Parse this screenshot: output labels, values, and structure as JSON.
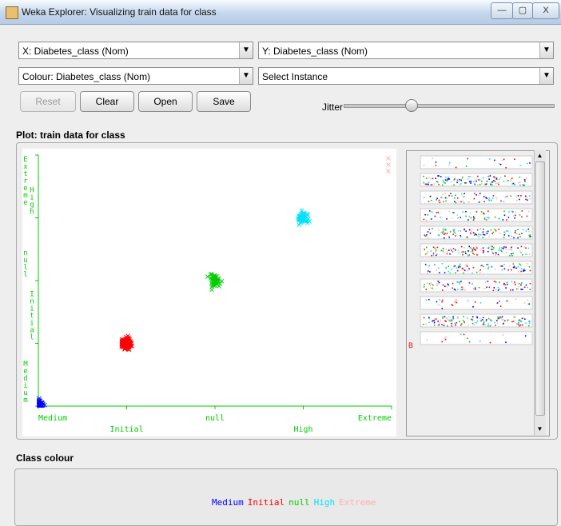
{
  "window": {
    "title": "Weka Explorer: Visualizing train data for class",
    "minimize_label": "—",
    "maximize_label": "▢",
    "close_label": "X"
  },
  "controls": {
    "x_axis": "X: Diabetes_class (Nom)",
    "y_axis": "Y: Diabetes_class (Nom)",
    "colour": "Colour: Diabetes_class (Nom)",
    "select_instance": "Select Instance",
    "reset_label": "Reset",
    "clear_label": "Clear",
    "open_label": "Open",
    "save_label": "Save",
    "jitter_label": "Jitter",
    "jitter_level": 0.32
  },
  "plot": {
    "section_label": "Plot: train data for class",
    "x_ticks": [
      "Medium",
      "Initial",
      "null",
      "High",
      "Extreme"
    ],
    "y_ticks": [
      "Medium",
      "Initial",
      "null",
      "High",
      "Extreme"
    ],
    "axis_color": "#00cc00",
    "b_label": "B"
  },
  "class_colour": {
    "section_label": "Class colour",
    "entries": [
      {
        "label": "Medium",
        "color": "#0000ff"
      },
      {
        "label": "Initial",
        "color": "#ff0000"
      },
      {
        "label": "null",
        "color": "#00cc00"
      },
      {
        "label": "High",
        "color": "#00e0ff"
      },
      {
        "label": "Extreme",
        "color": "#ffb0b0"
      }
    ]
  },
  "chart_data": {
    "type": "scatter",
    "x_categories": [
      "Medium",
      "Initial",
      "null",
      "High",
      "Extreme"
    ],
    "y_categories": [
      "Medium",
      "Initial",
      "null",
      "High",
      "Extreme"
    ],
    "series": [
      {
        "name": "Medium",
        "x": "Medium",
        "y": "Medium",
        "color": "#0000ff",
        "density": "high"
      },
      {
        "name": "Initial",
        "x": "Initial",
        "y": "Initial",
        "color": "#ff0000",
        "density": "high"
      },
      {
        "name": "null",
        "x": "null",
        "y": "null",
        "color": "#00cc00",
        "density": "medium"
      },
      {
        "name": "High",
        "x": "High",
        "y": "High",
        "color": "#00e0ff",
        "density": "medium"
      },
      {
        "name": "Extreme",
        "x": "Extreme",
        "y": "Extreme",
        "color": "#ffb0b0",
        "density": "low"
      }
    ],
    "marker": "x"
  }
}
